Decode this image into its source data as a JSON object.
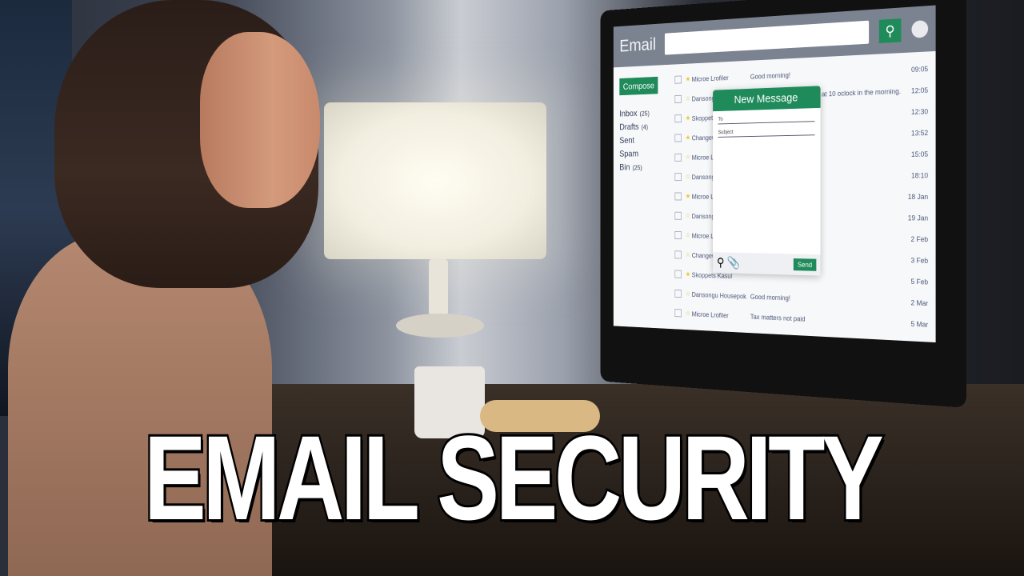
{
  "headline": "EMAIL SECURITY",
  "email_app": {
    "title": "Email",
    "search": {
      "placeholder": "",
      "icon": "search-icon"
    },
    "compose_label": "Compose",
    "folders": [
      {
        "label": "Inbox",
        "count": "(25)"
      },
      {
        "label": "Drafts",
        "count": "(4)"
      },
      {
        "label": "Sent",
        "count": ""
      },
      {
        "label": "Spam",
        "count": ""
      },
      {
        "label": "Bin",
        "count": "(25)"
      }
    ],
    "messages": [
      {
        "sender": "Microe Lrofiler",
        "subject": "Good morning!",
        "time": "09:05",
        "starred": true
      },
      {
        "sender": "Dansongu Housepok",
        "subject": "Today we have a meeting at 10 oclock in the morning.",
        "time": "12:05",
        "starred": false
      },
      {
        "sender": "Skoppets Kiesa",
        "subject": "",
        "time": "12:30",
        "starred": true
      },
      {
        "sender": "Changews Hat",
        "subject": "",
        "time": "13:52",
        "starred": true
      },
      {
        "sender": "Microe Lrofiler",
        "subject": "",
        "time": "15:05",
        "starred": false
      },
      {
        "sender": "Dansongu Housepok",
        "subject": "",
        "time": "18:10",
        "starred": false
      },
      {
        "sender": "Microe Lrofiler",
        "subject": "",
        "time": "18 Jan",
        "starred": true
      },
      {
        "sender": "Dansongu Housepok",
        "subject": "",
        "time": "19 Jan",
        "starred": false
      },
      {
        "sender": "Microe Lrofiler",
        "subject": "",
        "time": "2 Feb",
        "starred": false
      },
      {
        "sender": "Changews Hat",
        "subject": "",
        "time": "3 Feb",
        "starred": false
      },
      {
        "sender": "Skoppets Kasul",
        "subject": "",
        "time": "5 Feb",
        "starred": true
      },
      {
        "sender": "Dansongu Housepok",
        "subject": "Good morning!",
        "time": "2 Mar",
        "starred": false
      },
      {
        "sender": "Microe Lrofiler",
        "subject": "Tax matters not paid",
        "time": "5 Mar",
        "starred": false
      }
    ],
    "new_message": {
      "title": "New Message",
      "to_label": "To",
      "subject_label": "Subject",
      "send_label": "Send"
    }
  },
  "colors": {
    "accent": "#1f8a5a",
    "topbar": "#7b8290"
  }
}
